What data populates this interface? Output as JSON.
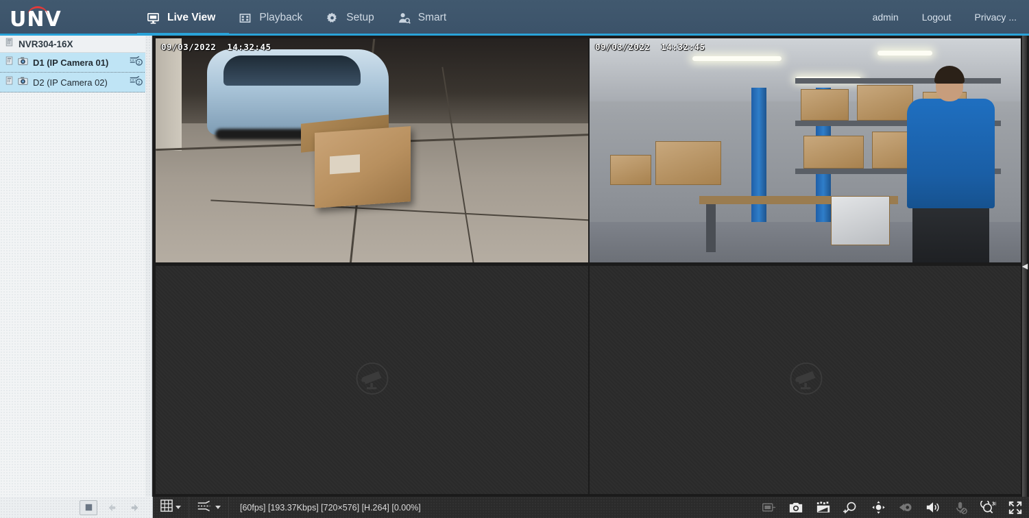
{
  "header": {
    "logo_text": "UNV",
    "nav": [
      {
        "label": "Live View",
        "icon": "monitor-icon",
        "active": true
      },
      {
        "label": "Playback",
        "icon": "film-icon",
        "active": false
      },
      {
        "label": "Setup",
        "icon": "gear-icon",
        "active": false
      },
      {
        "label": "Smart",
        "icon": "person-search-icon",
        "active": false
      }
    ],
    "user": "admin",
    "logout": "Logout",
    "privacy": "Privacy ..."
  },
  "sidebar": {
    "device": "NVR304-16X",
    "channels": [
      {
        "label": "D1 (IP Camera 01)",
        "selected": true,
        "stream": "2"
      },
      {
        "label": "D2 (IP Camera 02)",
        "selected": false,
        "stream": "2"
      }
    ]
  },
  "video": {
    "cells": [
      {
        "timestamp": "09/03/2022  14:32:45",
        "selected": true,
        "empty": false
      },
      {
        "timestamp": "09/03/2022  14:32:45",
        "selected": false,
        "empty": false
      },
      {
        "timestamp": "",
        "selected": false,
        "empty": true
      },
      {
        "timestamp": "",
        "selected": false,
        "empty": true
      }
    ]
  },
  "bottom": {
    "stop_button": "stop-button",
    "prev_button": "previous-page-button",
    "next_button": "next-page-button",
    "layout_button": "screen-layout-button",
    "stream_button": "stream-type-button",
    "status": "[60fps] [193.37Kbps] [720×576] [H.264] [0.00%]",
    "tools": [
      {
        "name": "preview-icon",
        "dim": true
      },
      {
        "name": "snapshot-icon",
        "dim": false
      },
      {
        "name": "record-clip-icon",
        "dim": false
      },
      {
        "name": "digital-zoom-icon",
        "dim": false
      },
      {
        "name": "ptz-control-icon",
        "dim": false
      },
      {
        "name": "fisheye-icon",
        "dim": true
      },
      {
        "name": "volume-icon",
        "dim": false
      },
      {
        "name": "microphone-muted-icon",
        "dim": true
      },
      {
        "name": "three-d-positioning-icon",
        "dim": false
      },
      {
        "name": "fullscreen-icon",
        "dim": false
      }
    ]
  },
  "rail": {
    "collapse_glyph": "◀"
  },
  "colors": {
    "header_bg": "#3d556d",
    "accent": "#29a3d9",
    "selection": "#2ec3f0",
    "tree_row": "#bfe4f5",
    "sidebar_bg": "#f2f4f5",
    "toolbar_bg": "#2b2b2b"
  }
}
